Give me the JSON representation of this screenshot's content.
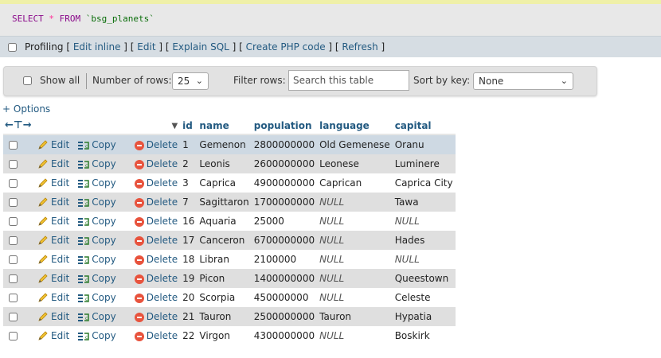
{
  "sql": {
    "select": "SELECT",
    "star": "*",
    "from": "FROM",
    "table": "`bsg_planets`"
  },
  "profiling": {
    "label": "Profiling",
    "links": [
      "Edit inline",
      "Edit",
      "Explain SQL",
      "Create PHP code",
      "Refresh"
    ]
  },
  "navbar": {
    "show_all": "Show all",
    "num_rows_label": "Number of rows:",
    "num_rows_value": "25",
    "filter_label": "Filter rows:",
    "filter_placeholder": "Search this table",
    "sort_label": "Sort by key:",
    "sort_value": "None"
  },
  "options_link": "+ Options",
  "columns": [
    "id",
    "name",
    "population",
    "language",
    "capital"
  ],
  "actions": {
    "edit": "Edit",
    "copy": "Copy",
    "delete": "Delete"
  },
  "rows": [
    {
      "id": "1",
      "name": "Gemenon",
      "population": "2800000000",
      "language": "Old Gemenese",
      "capital": "Oranu"
    },
    {
      "id": "2",
      "name": "Leonis",
      "population": "2600000000",
      "language": "Leonese",
      "capital": "Luminere"
    },
    {
      "id": "3",
      "name": "Caprica",
      "population": "4900000000",
      "language": "Caprican",
      "capital": "Caprica City"
    },
    {
      "id": "7",
      "name": "Sagittaron",
      "population": "1700000000",
      "language": "NULL",
      "capital": "Tawa"
    },
    {
      "id": "16",
      "name": "Aquaria",
      "population": "25000",
      "language": "NULL",
      "capital": "NULL"
    },
    {
      "id": "17",
      "name": "Canceron",
      "population": "6700000000",
      "language": "NULL",
      "capital": "Hades"
    },
    {
      "id": "18",
      "name": "Libran",
      "population": "2100000",
      "language": "NULL",
      "capital": "NULL"
    },
    {
      "id": "19",
      "name": "Picon",
      "population": "1400000000",
      "language": "NULL",
      "capital": "Queestown"
    },
    {
      "id": "20",
      "name": "Scorpia",
      "population": "450000000",
      "language": "NULL",
      "capital": "Celeste"
    },
    {
      "id": "21",
      "name": "Tauron",
      "population": "2500000000",
      "language": "Tauron",
      "capital": "Hypatia"
    },
    {
      "id": "22",
      "name": "Virgon",
      "population": "4300000000",
      "language": "NULL",
      "capital": "Boskirk"
    }
  ]
}
